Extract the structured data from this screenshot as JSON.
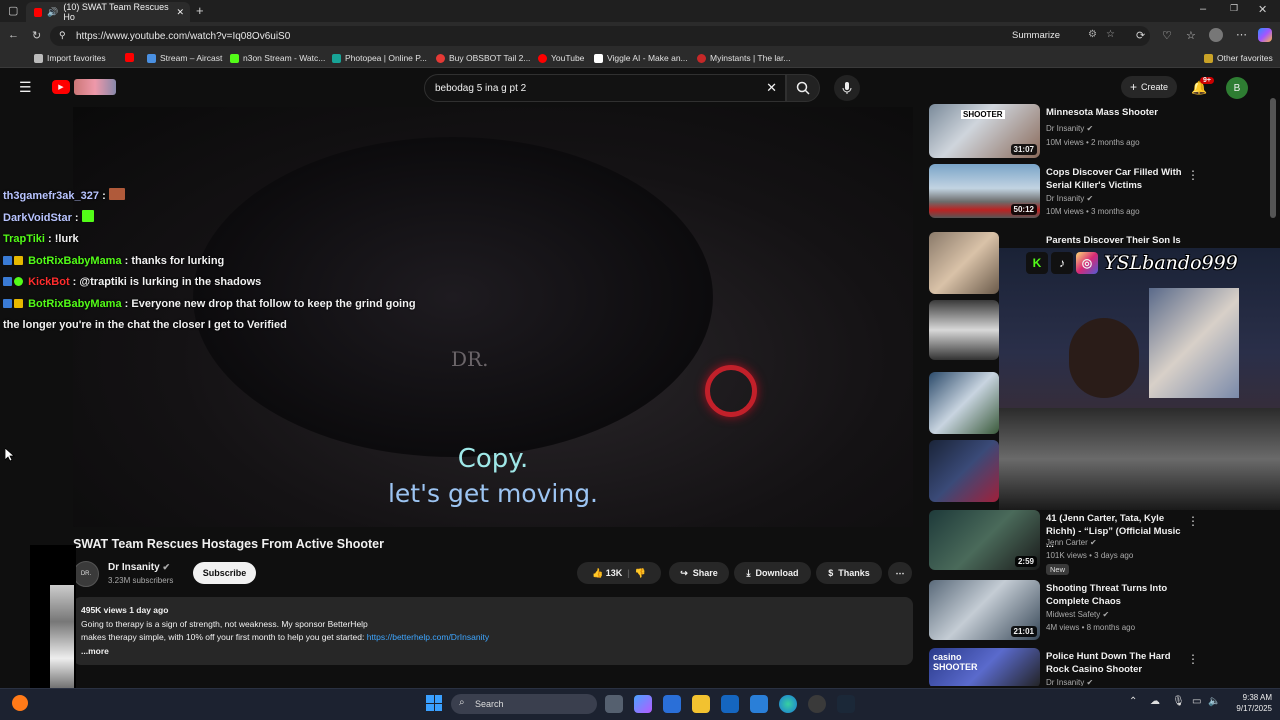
{
  "browser": {
    "tab_title": "(10) SWAT Team Rescues Ho",
    "url": "https://www.youtube.com/watch?v=Iq08Ov6uiS0",
    "summarize_label": "Summarize",
    "bookmarks": [
      "Import favorites",
      "Stream – Aircast",
      "n3on Stream - Watc...",
      "Photopea | Online P...",
      "Buy OBSBOT Tail 2...",
      "YouTube",
      "Viggle AI - Make an...",
      "Myinstants | The lar..."
    ],
    "other_favorites": "Other favorites"
  },
  "youtube": {
    "search_value": "bebodag 5 ina g pt 2",
    "create_label": "Create",
    "notif_count": "9+",
    "avatar_letter": "B"
  },
  "video": {
    "watermark": "DR.",
    "caption_line1": "Copy.",
    "caption_line2": "let's get moving.",
    "chat": [
      {
        "user": "th3gamefr3ak_327",
        "msg": "",
        "color": "#b8c4ff"
      },
      {
        "user": "DarkVoidStar",
        "msg": "",
        "color": "#b8c4ff"
      },
      {
        "user": "TrapTiki",
        "msg": "!lurk",
        "color": "#53fc18"
      },
      {
        "user": "BotRixBabyMama",
        "msg": "thanks for lurking",
        "color": "#53fc18"
      },
      {
        "user": "KickBot",
        "msg": "@traptiki is lurking in the shadows",
        "color": "#ff2d2d"
      },
      {
        "user": "BotRixBabyMama",
        "msg": "Everyone new drop that follow to keep the grind going",
        "color": "#53fc18"
      }
    ],
    "chat_continuation": "the longer you're in the chat the closer I get to Verified"
  },
  "meta": {
    "title": "SWAT Team Rescues Hostages From Active Shooter",
    "channel": "Dr Insanity",
    "channel_avatar_text": "DR.",
    "subscribers": "3.23M subscribers",
    "subscribe_label": "Subscribe",
    "likes": "13K",
    "share_label": "Share",
    "download_label": "Download",
    "thanks_label": "Thanks",
    "views_date": "495K views  1 day ago",
    "desc_line1": "Going to therapy is a sign of strength, not weakness. My sponsor BetterHelp",
    "desc_line2": "makes therapy simple, with 10% off your first month to help you get started:",
    "desc_link": "https://betterhelp.com/DrInsanity",
    "more_label": "...more"
  },
  "recommendations": [
    {
      "title": "Minnesota Mass Shooter",
      "channel": "Dr Insanity",
      "meta": "10M views • 2 months ago",
      "duration": "31:07",
      "thumb_text": "SHOOTER"
    },
    {
      "title": "Cops Discover Car Filled With Serial Killer's Victims",
      "channel": "Dr Insanity",
      "meta": "10M views • 3 months ago",
      "duration": "50:12",
      "thumb_text": ""
    },
    {
      "title": "Parents Discover Their Son Is A",
      "channel": "",
      "meta": "",
      "duration": "",
      "thumb_text": ""
    },
    {
      "title": "41 (Jenn Carter, Tata, Kyle Richh) - “Lisp” (Official Music ...",
      "channel": "Jenn Carter",
      "meta": "101K views • 3 days ago",
      "duration": "2:59",
      "badge": "New",
      "thumb_text": ""
    },
    {
      "title": "Shooting Threat Turns Into Complete Chaos",
      "channel": "Midwest Safety",
      "meta": "4M views • 8 months ago",
      "duration": "21:01",
      "thumb_text": ""
    },
    {
      "title": "Police Hunt Down The Hard Rock Casino Shooter",
      "channel": "Dr Insanity",
      "meta": "",
      "duration": "",
      "thumb_text": "casino SHOOTER"
    }
  ],
  "webcam": {
    "handle": "YSLbando999",
    "social_icons": [
      "kick-icon",
      "tiktok-icon",
      "instagram-icon"
    ]
  },
  "taskbar": {
    "search_placeholder": "Search",
    "time": "9:38 AM",
    "date": "9/17/2025"
  }
}
